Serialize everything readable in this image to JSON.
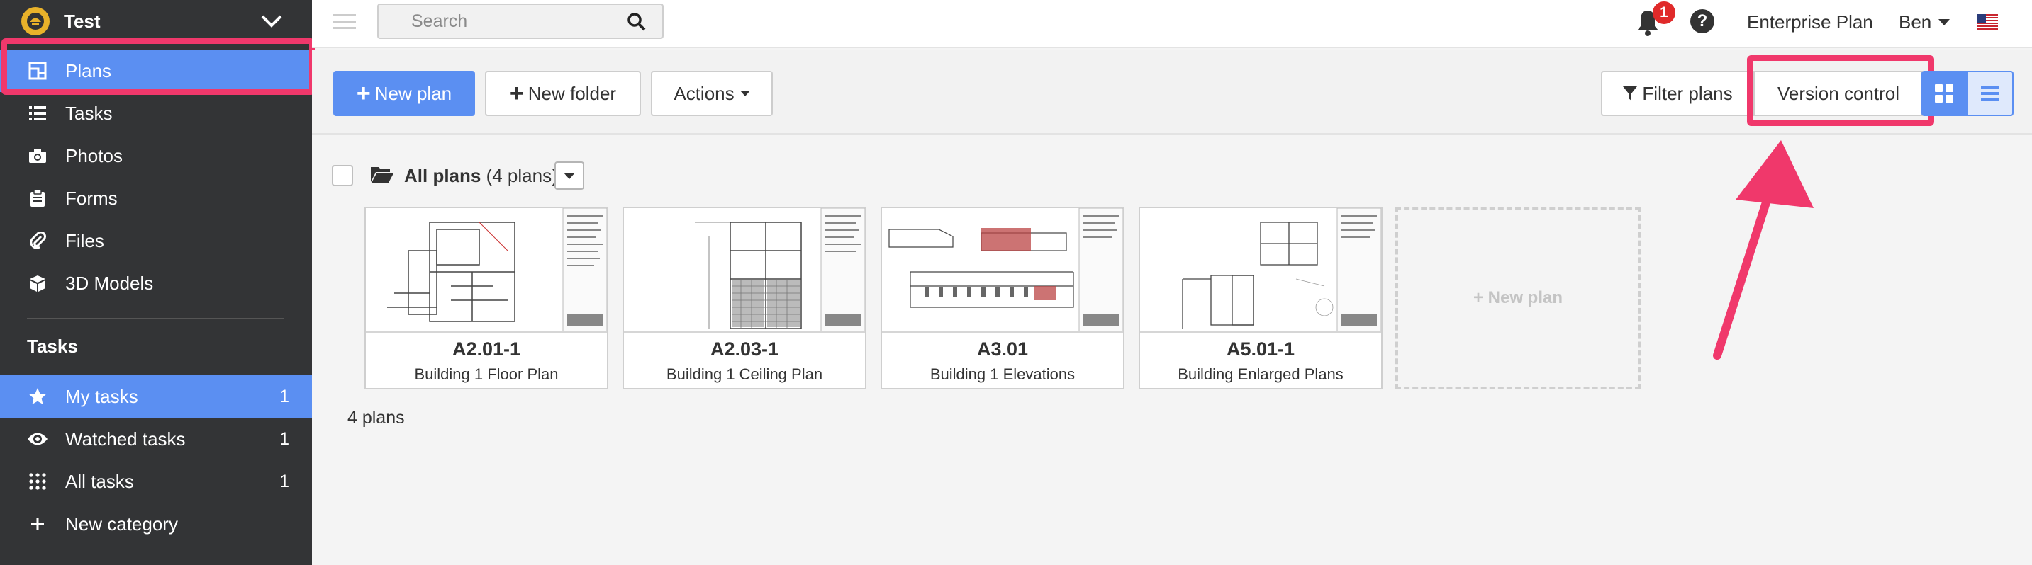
{
  "sidebar": {
    "project_name": "Test",
    "nav": [
      {
        "label": "Plans"
      },
      {
        "label": "Tasks"
      },
      {
        "label": "Photos"
      },
      {
        "label": "Forms"
      },
      {
        "label": "Files"
      },
      {
        "label": "3D Models"
      }
    ],
    "tasks_section": {
      "title": "Tasks",
      "items": [
        {
          "label": "My tasks",
          "count": "1"
        },
        {
          "label": "Watched tasks",
          "count": "1"
        },
        {
          "label": "All tasks",
          "count": "1"
        },
        {
          "label": "New category"
        }
      ]
    }
  },
  "header": {
    "search_placeholder": "Search",
    "notification_count": "1",
    "help_label": "?",
    "plan_label": "Enterprise Plan",
    "user_name": "Ben"
  },
  "toolbar": {
    "new_plan": "New plan",
    "new_folder": "New folder",
    "actions": "Actions",
    "filter_plans": "Filter plans",
    "version_control": "Version control"
  },
  "folder": {
    "title": "All plans",
    "subtitle": "(4 plans)"
  },
  "plans": [
    {
      "code": "A2.01-1",
      "name": "Building 1 Floor Plan"
    },
    {
      "code": "A2.03-1",
      "name": "Building 1 Ceiling Plan"
    },
    {
      "code": "A3.01",
      "name": "Building 1 Elevations"
    },
    {
      "code": "A5.01-1",
      "name": "Building Enlarged Plans"
    }
  ],
  "new_plan_card": "+ New plan",
  "plan_count": "4 plans",
  "colors": {
    "sidebar_bg": "#333436",
    "accent_blue": "#5b8ff2",
    "highlight_pink": "#f0386b",
    "badge_red": "#e02a2a"
  }
}
